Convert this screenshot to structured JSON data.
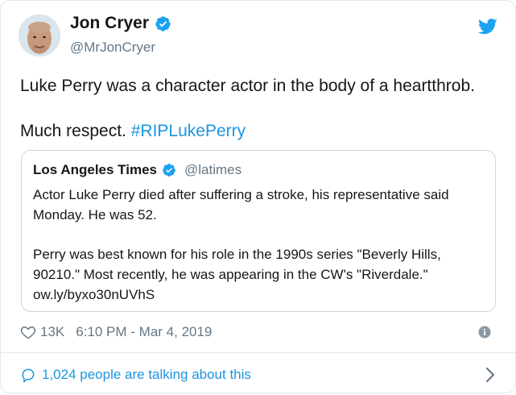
{
  "author": {
    "name": "Jon Cryer",
    "handle": "@MrJonCryer",
    "verified_icon": "verified-badge-icon",
    "avatar": "avatar-photo"
  },
  "platform_icon": "twitter-bird-icon",
  "tweet": {
    "line1": "Luke Perry was a character actor in the body of a heartthrob.",
    "line2_prefix": "Much respect. ",
    "hashtag": "#RIPLukePerry"
  },
  "quoted_tweet": {
    "name": "Los Angeles Times",
    "handle": "@latimes",
    "paragraph1": "Actor Luke Perry died after suffering a stroke, his representative said Monday. He was 52.",
    "paragraph2": "Perry was best known for his role in the 1990s series \"Beverly Hills, 90210.\" Most recently, he was appearing in the CW's \"Riverdale.\" ow.ly/byxo30nUVhS"
  },
  "meta": {
    "likes": "13K",
    "timestamp": "6:10 PM - Mar 4, 2019"
  },
  "footer": {
    "talking_text": "1,024 people are talking about this"
  },
  "colors": {
    "link": "#1b95e0",
    "secondary_text": "#657786",
    "primary_text": "#14171a",
    "border": "#e1e8ed"
  }
}
